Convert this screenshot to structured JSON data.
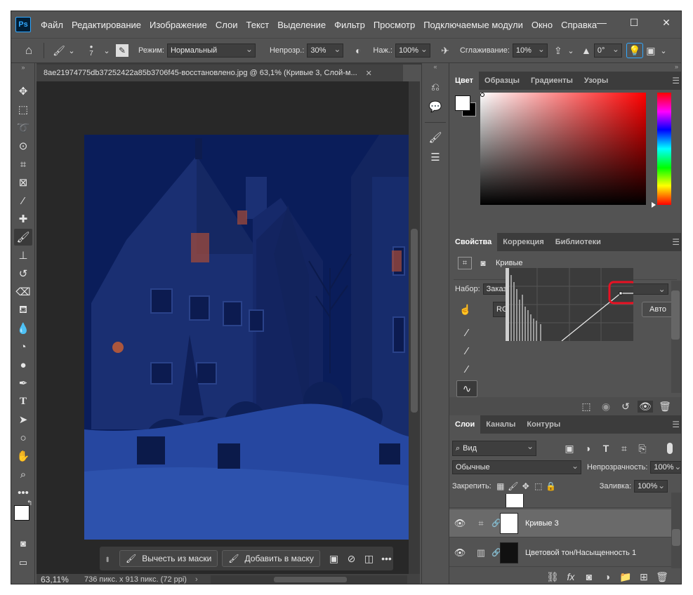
{
  "app": {
    "logo": "Ps"
  },
  "menu": [
    "Файл",
    "Редактирование",
    "Изображение",
    "Слои",
    "Текст",
    "Выделение",
    "Фильтр",
    "Просмотр",
    "Подключаемые модули",
    "Окно",
    "Справка"
  ],
  "window_controls": {
    "minimize": "—",
    "maximize": "☐",
    "close": "✕"
  },
  "options": {
    "brush_size": "7",
    "mode_label": "Режим:",
    "mode_value": "Нормальный",
    "opacity_label": "Непрозр.:",
    "opacity_value": "30%",
    "pressure_label": "Наж.:",
    "pressure_value": "100%",
    "smoothing_label": "Сглаживание:",
    "smoothing_value": "10%",
    "angle_value": "0°"
  },
  "document": {
    "tab_title": "8ae21974775db37252422a85b3706f45-восстановлено.jpg @ 63,1% (Кривые 3, Слой-м...",
    "zoom": "63,11%",
    "info": "736 пикс. x 913 пикс. (72 ppi)"
  },
  "floatbar": {
    "subtract": "Вычесть из маски",
    "add": "Добавить в маску"
  },
  "color_panel": {
    "tabs": [
      "Цвет",
      "Образцы",
      "Градиенты",
      "Узоры"
    ],
    "fg_color": "#ffffff",
    "bg_color": "#000000"
  },
  "properties_panel": {
    "tabs": [
      "Свойства",
      "Коррекция",
      "Библиотеки"
    ],
    "type_label": "Кривые",
    "preset_label": "Набор:",
    "preset_value": "Заказная",
    "channel_value": "RGB",
    "auto_label": "Авто"
  },
  "layers_panel": {
    "tabs": [
      "Слои",
      "Каналы",
      "Контуры"
    ],
    "filter_value": "Вид",
    "blend_value": "Обычные",
    "opacity_label": "Непрозрачность:",
    "opacity_value": "100%",
    "lock_label": "Закрепить:",
    "fill_label": "Заливка:",
    "fill_value": "100%",
    "layers": [
      {
        "name": "Кривые 3",
        "selected": true
      },
      {
        "name": "Цветовой тон/Насыщенность 1",
        "selected": false
      }
    ]
  },
  "colors": {
    "highlight": "#e81123",
    "accent": "#31a8ff"
  }
}
